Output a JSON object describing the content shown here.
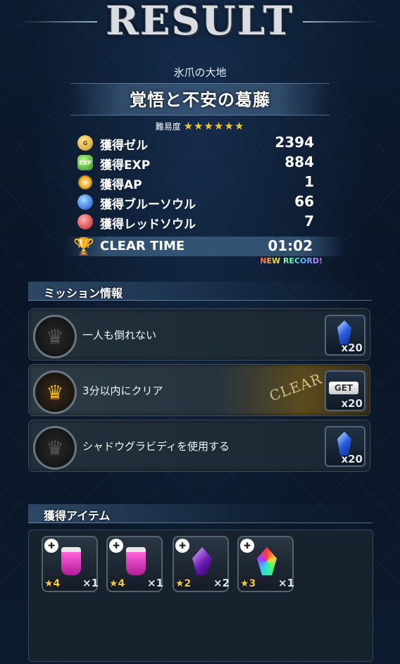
{
  "header": {
    "title": "RESULT"
  },
  "quest": {
    "area_name": "氷爪の大地",
    "name": "覚悟と不安の葛藤",
    "difficulty_label": "難易度",
    "difficulty_stars": "★★★★★★"
  },
  "stats": [
    {
      "icon": "gil-coin-icon",
      "label": "獲得ゼル",
      "value": "2394"
    },
    {
      "icon": "exp-icon",
      "label": "獲得EXP",
      "value": "884"
    },
    {
      "icon": "ap-icon",
      "label": "獲得AP",
      "value": "1"
    },
    {
      "icon": "blue-soul-icon",
      "label": "獲得ブルーソウル",
      "value": "66"
    },
    {
      "icon": "red-soul-icon",
      "label": "獲得レッドソウル",
      "value": "7"
    }
  ],
  "clear_time": {
    "label": "CLEAR TIME",
    "value": "01:02",
    "badge": "NEW RECORD!"
  },
  "missions": {
    "heading": "ミッション情報",
    "items": [
      {
        "text": "一人も倒れない",
        "cleared": false,
        "reward_qty": "x20"
      },
      {
        "text": "3分以内にクリア",
        "cleared": true,
        "reward_qty": "x20",
        "get_label": "GET",
        "stamp": "CLEAR"
      },
      {
        "text": "シャドウグラビディを使用する",
        "cleared": false,
        "reward_qty": "x20"
      }
    ]
  },
  "items": {
    "heading": "獲得アイテム",
    "list": [
      {
        "art": "potion",
        "rarity": "★4",
        "qty": "×1"
      },
      {
        "art": "potion",
        "rarity": "★4",
        "qty": "×1"
      },
      {
        "art": "purple-crystal",
        "rarity": "★2",
        "qty": "×2"
      },
      {
        "art": "rainbow-crystal",
        "rarity": "★3",
        "qty": "×1"
      }
    ]
  },
  "colors": {
    "accent_gold": "#e7b629",
    "star": "#f4c430",
    "panel": "#16222e"
  }
}
